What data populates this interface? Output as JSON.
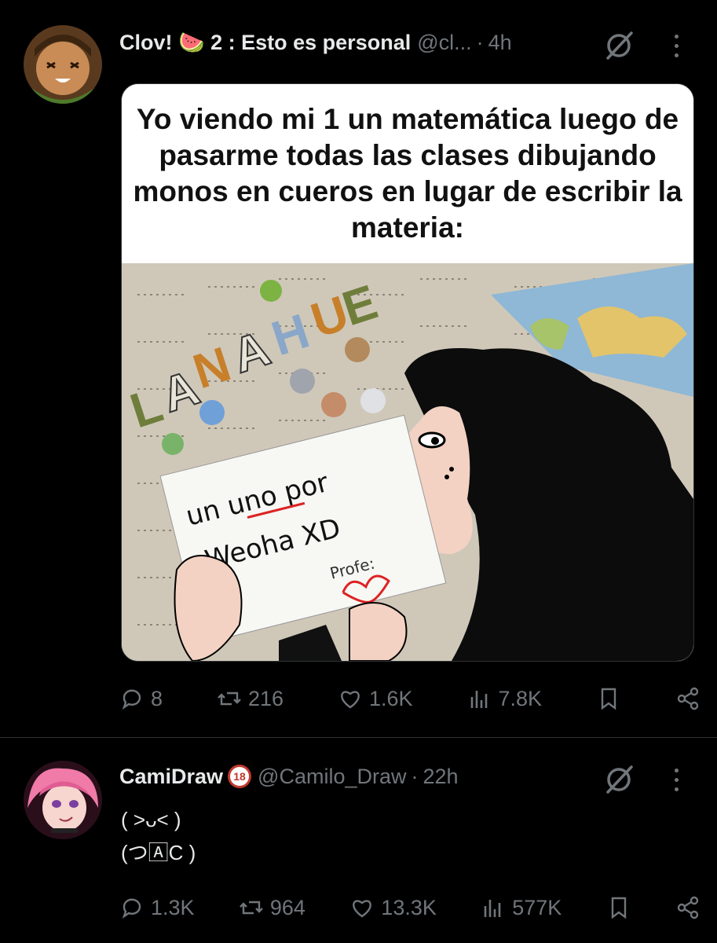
{
  "post1": {
    "author_name": "Clov! 🍉 2 : Esto es personal",
    "handle": "@cl...",
    "separator": "·",
    "time": "4h",
    "meme": {
      "caption": "Yo viendo mi 1 un matemática luego de pasarme todas las clases dibujando monos en cueros en lugar de escribir la materia:",
      "paper_line1": "un uno por",
      "paper_line2": "Weoha XD",
      "paper_sign": "Profe:",
      "wall_letters": "NAHUE"
    },
    "stats": {
      "replies": "8",
      "reposts": "216",
      "likes": "1.6K",
      "views": "7.8K"
    }
  },
  "post2": {
    "author_name": "CamiDraw",
    "badge": "18",
    "handle": "@Camilo_Draw",
    "separator": "·",
    "time": "22h",
    "text_line1": "( ˃ᴗ˂ )",
    "text_line2": "(つ🄰C )",
    "stats": {
      "replies": "1.3K",
      "reposts": "964",
      "likes": "13.3K",
      "views": "577K"
    }
  },
  "colors": {
    "background": "#000000",
    "text_primary": "#e7e9ea",
    "text_secondary": "#71767b",
    "divider": "#2f3336"
  },
  "icons": [
    "reply-icon",
    "repost-icon",
    "like-icon",
    "views-icon",
    "bookmark-icon",
    "share-icon",
    "grok-icon",
    "more-icon"
  ]
}
